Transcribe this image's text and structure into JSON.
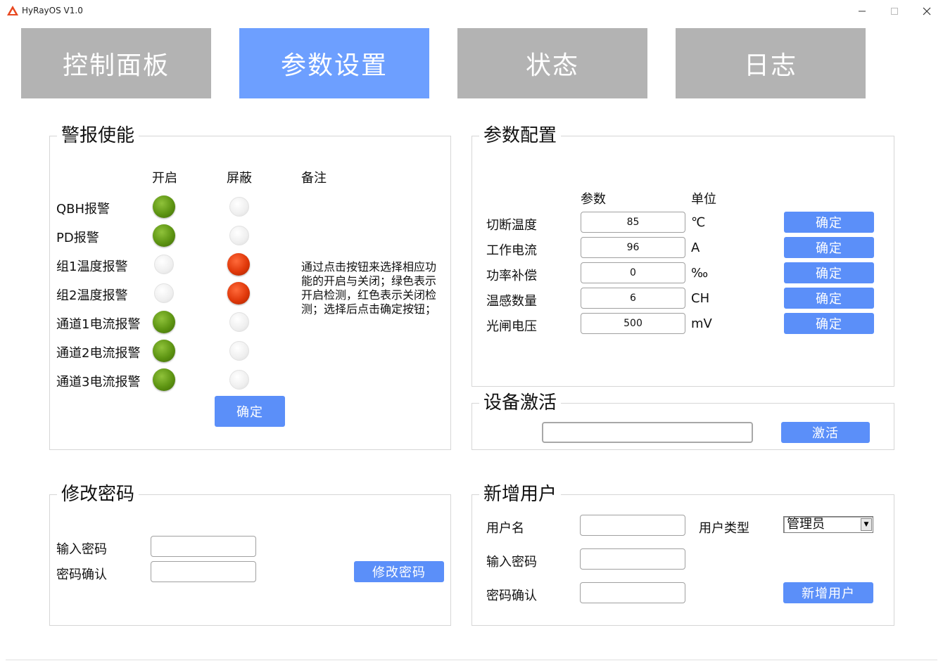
{
  "window": {
    "title": "HyRayOS V1.0"
  },
  "tabs": [
    {
      "label": "控制面板"
    },
    {
      "label": "参数设置"
    },
    {
      "label": "状态"
    },
    {
      "label": "日志"
    }
  ],
  "alarm": {
    "title": "警报使能",
    "col_on": "开启",
    "col_mask": "屏蔽",
    "col_note": "备注",
    "rows": [
      {
        "label": "QBH报警",
        "on": true
      },
      {
        "label": "PD报警",
        "on": true
      },
      {
        "label": "组1温度报警",
        "on": false
      },
      {
        "label": "组2温度报警",
        "on": false
      },
      {
        "label": "通道1电流报警",
        "on": true
      },
      {
        "label": "通道2电流报警",
        "on": true
      },
      {
        "label": "通道3电流报警",
        "on": true
      }
    ],
    "note": "通过点击按钮来选择相应功能的开启与关闭；绿色表示开启检测，红色表示关闭检测；选择后点击确定按钮；",
    "confirm": "确定"
  },
  "params": {
    "title": "参数配置",
    "col_param": "参数",
    "col_unit": "单位",
    "rows": [
      {
        "label": "切断温度",
        "value": "85",
        "unit": "℃",
        "btn": "确定"
      },
      {
        "label": "工作电流",
        "value": "96",
        "unit": "A",
        "btn": "确定"
      },
      {
        "label": "功率补偿",
        "value": "0",
        "unit": "‰",
        "btn": "确定"
      },
      {
        "label": "温感数量",
        "value": "6",
        "unit": "CH",
        "btn": "确定"
      },
      {
        "label": "光闸电压",
        "value": "500",
        "unit": "mV",
        "btn": "确定"
      }
    ]
  },
  "activate": {
    "title": "设备激活",
    "value": "",
    "btn": "激活"
  },
  "password": {
    "title": "修改密码",
    "input_label": "输入密码",
    "confirm_label": "密码确认",
    "btn": "修改密码"
  },
  "newuser": {
    "title": "新增用户",
    "username_label": "用户名",
    "type_label": "用户类型",
    "type_value": "管理员",
    "input_label": "输入密码",
    "confirm_label": "密码确认",
    "btn": "新增用户"
  },
  "colors": {
    "tab_active": "#6d9fff",
    "tab_inactive": "#b3b3b3",
    "button": "#5b8ff9",
    "led_on": "#5d9412",
    "led_off": "#e0380a"
  }
}
